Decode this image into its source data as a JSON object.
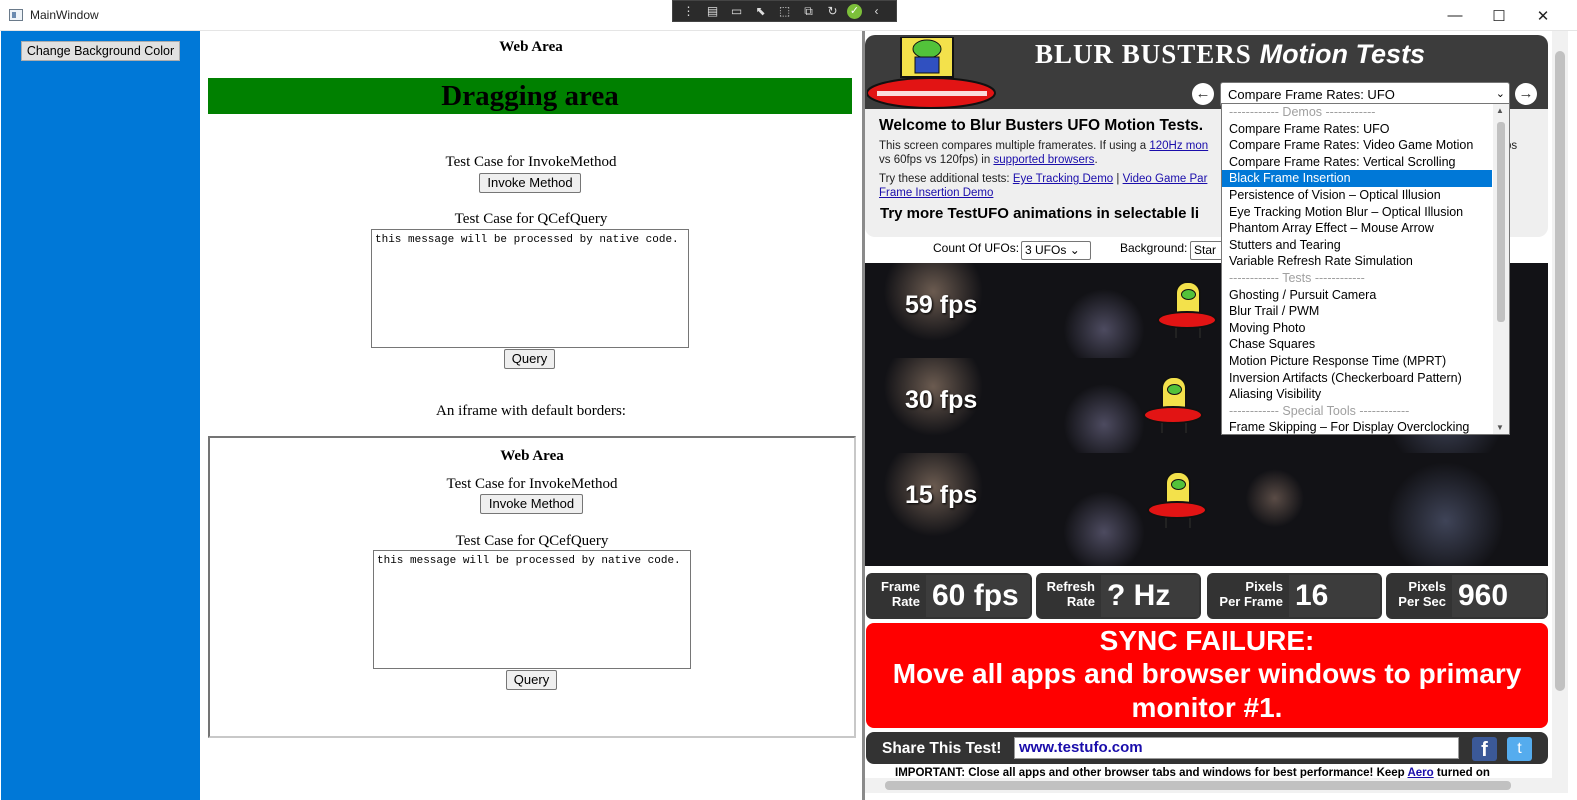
{
  "window": {
    "title": "MainWindow",
    "minimize": "—",
    "maximize": "☐",
    "close": "✕"
  },
  "left_panel": {
    "button": "Change Background Color",
    "color": "#0078d7"
  },
  "web_area": {
    "heading": "Web Area",
    "drag_label": "Dragging area",
    "invoke_label": "Test Case for InvokeMethod",
    "invoke_button": "Invoke Method",
    "query_label": "Test Case for QCefQuery",
    "query_text": "this message will be processed by native code.",
    "query_button": "Query",
    "iframe_label": "An iframe with default borders:",
    "iframe": {
      "heading": "Web Area",
      "invoke_label": "Test Case for InvokeMethod",
      "invoke_button": "Invoke Method",
      "query_label": "Test Case for QCefQuery",
      "query_text": "this message will be processed by native code.",
      "query_button": "Query"
    }
  },
  "testufo": {
    "title_main": "BLUR  BUSTERS",
    "title_italic": "Motion Tests",
    "select_value": "Compare Frame Rates: UFO",
    "welcome": "Welcome to Blur Busters UFO Motion Tests.",
    "desc_1": "This screen compares multiple framerates. If using a",
    "desc_link_1": "120Hz mon",
    "desc_tail": "ps",
    "desc_2": "vs 60fps vs 120fps) in",
    "desc_link_2": "supported browsers",
    "try_prefix": "Try these additional tests:",
    "try_link_1": "Eye Tracking Demo",
    "try_sep": "|",
    "try_link_2": "Video Game Par",
    "try_link_3": "Frame Insertion Demo",
    "try_more": "Try more TestUFO animations in selectable li",
    "count_label": "Count Of UFOs:",
    "count_value": "3 UFOs",
    "bg_label": "Background:",
    "bg_value": "Star",
    "rows": [
      "59 fps",
      "30 fps",
      "15 fps"
    ],
    "stats": {
      "frame_rate_k1": "Frame",
      "frame_rate_k2": "Rate",
      "frame_rate_v": "60 fps",
      "refresh_k1": "Refresh",
      "refresh_k2": "Rate",
      "refresh_v": "? Hz",
      "ppf_k1": "Pixels",
      "ppf_k2": "Per Frame",
      "ppf_v": "16",
      "pps_k1": "Pixels",
      "pps_k2": "Per Sec",
      "pps_v": "960"
    },
    "sync_1": "SYNC FAILURE:",
    "sync_2": "Move all apps and browser windows to primary monitor #1.",
    "share_label": "Share This Test!",
    "share_url": "www.testufo.com",
    "facebook": "f",
    "twitter": "t",
    "important": "IMPORTANT: Close all apps and other browser tabs and windows for best performance! Keep",
    "important_link": "Aero",
    "important_tail": "turned on"
  },
  "dropdown": {
    "items": [
      {
        "text": "------------ Demos ------------",
        "group": true
      },
      {
        "text": "Compare Frame Rates: UFO"
      },
      {
        "text": "Compare Frame Rates: Video Game Motion"
      },
      {
        "text": "Compare Frame Rates: Vertical Scrolling"
      },
      {
        "text": "Black Frame Insertion",
        "highlight": true
      },
      {
        "text": "Persistence of Vision – Optical Illusion"
      },
      {
        "text": "Eye Tracking Motion Blur – Optical Illusion"
      },
      {
        "text": "Phantom Array Effect – Mouse Arrow"
      },
      {
        "text": "Stutters and Tearing"
      },
      {
        "text": "Variable Refresh Rate Simulation"
      },
      {
        "text": "------------ Tests ------------",
        "group": true
      },
      {
        "text": "Ghosting / Pursuit Camera"
      },
      {
        "text": "Blur Trail / PWM"
      },
      {
        "text": "Moving Photo"
      },
      {
        "text": "Chase Squares"
      },
      {
        "text": "Motion Picture Response Time (MPRT)"
      },
      {
        "text": "Inversion Artifacts (Checkerboard Pattern)"
      },
      {
        "text": "Aliasing Visibility"
      },
      {
        "text": "------------ Special Tools ------------",
        "group": true
      },
      {
        "text": "Frame Skipping – For Display Overclocking"
      }
    ]
  }
}
